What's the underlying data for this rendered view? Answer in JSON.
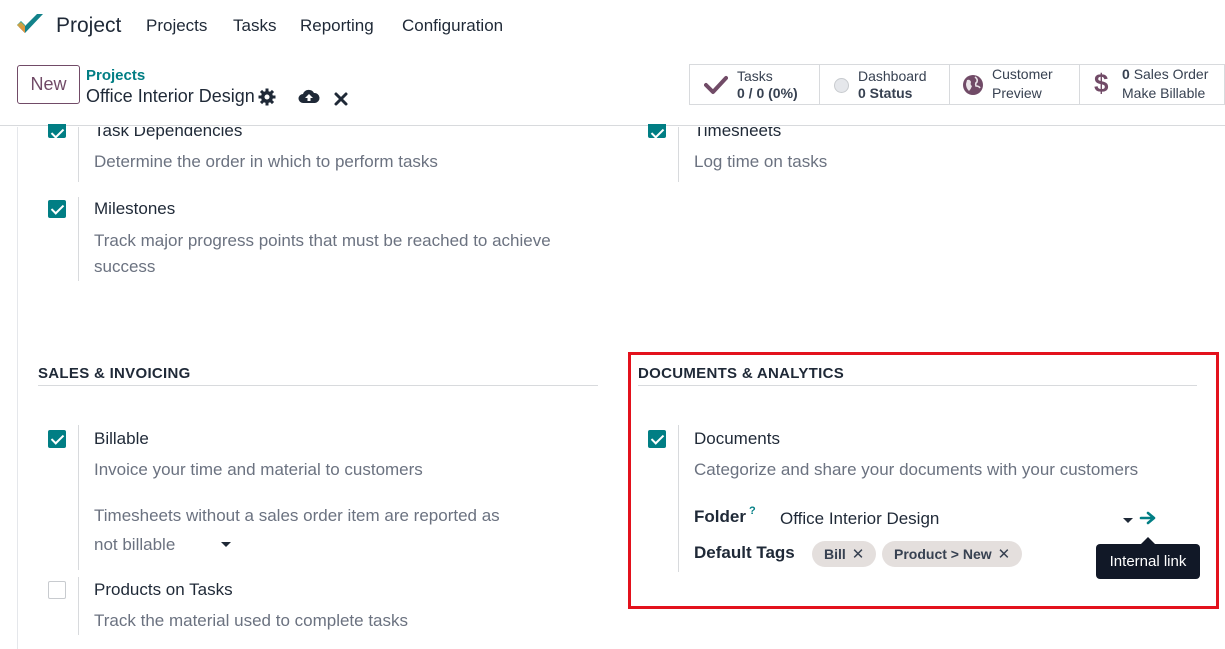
{
  "navbar": {
    "app_name": "Project",
    "menu": [
      "Projects",
      "Tasks",
      "Reporting",
      "Configuration"
    ]
  },
  "control_panel": {
    "new_label": "New",
    "breadcrumb_parent": "Projects",
    "breadcrumb_current": "Office Interior Design",
    "icons": [
      "gear-icon",
      "cloud-upload-icon",
      "close-icon"
    ]
  },
  "stat_buttons": {
    "tasks": {
      "line1": "Tasks",
      "line2": "0 / 0 (0%)"
    },
    "dashboard": {
      "line1": "Dashboard",
      "line2": "0 Status"
    },
    "customer": {
      "line1": "Customer",
      "line2": "Preview"
    },
    "sales": {
      "count": "0",
      "line1": "Sales Order",
      "line2": "Make Billable"
    }
  },
  "options": {
    "task_dependencies": {
      "title": "Task Dependencies",
      "desc": "Determine the order in which to perform tasks",
      "checked": true
    },
    "timesheets": {
      "title": "Timesheets",
      "desc": "Log time on tasks",
      "checked": true
    },
    "milestones": {
      "title": "Milestones",
      "desc": "Track major progress points that must be reached to achieve success",
      "checked": true
    },
    "billable": {
      "title": "Billable",
      "desc": "Invoice your time and material to customers",
      "checked": true,
      "extra": "Timesheets without a sales order item are reported as",
      "select_value": "not billable"
    },
    "products_on_tasks": {
      "title": "Products on Tasks",
      "desc": "Track the material used to complete tasks",
      "checked": false
    },
    "documents": {
      "title": "Documents",
      "desc": "Categorize and share your documents with your customers",
      "checked": true
    }
  },
  "sections": {
    "sales": "SALES & INVOICING",
    "documents": "DOCUMENTS & ANALYTICS"
  },
  "documents_fields": {
    "folder_label": "Folder",
    "help_mark": "?",
    "folder_value": "Office Interior Design",
    "tags_label": "Default Tags",
    "tags": [
      "Bill",
      "Product > New"
    ],
    "tooltip": "Internal link"
  },
  "colors": {
    "accent": "#017e84",
    "brand": "#714b67",
    "highlight": "#e3111c"
  }
}
